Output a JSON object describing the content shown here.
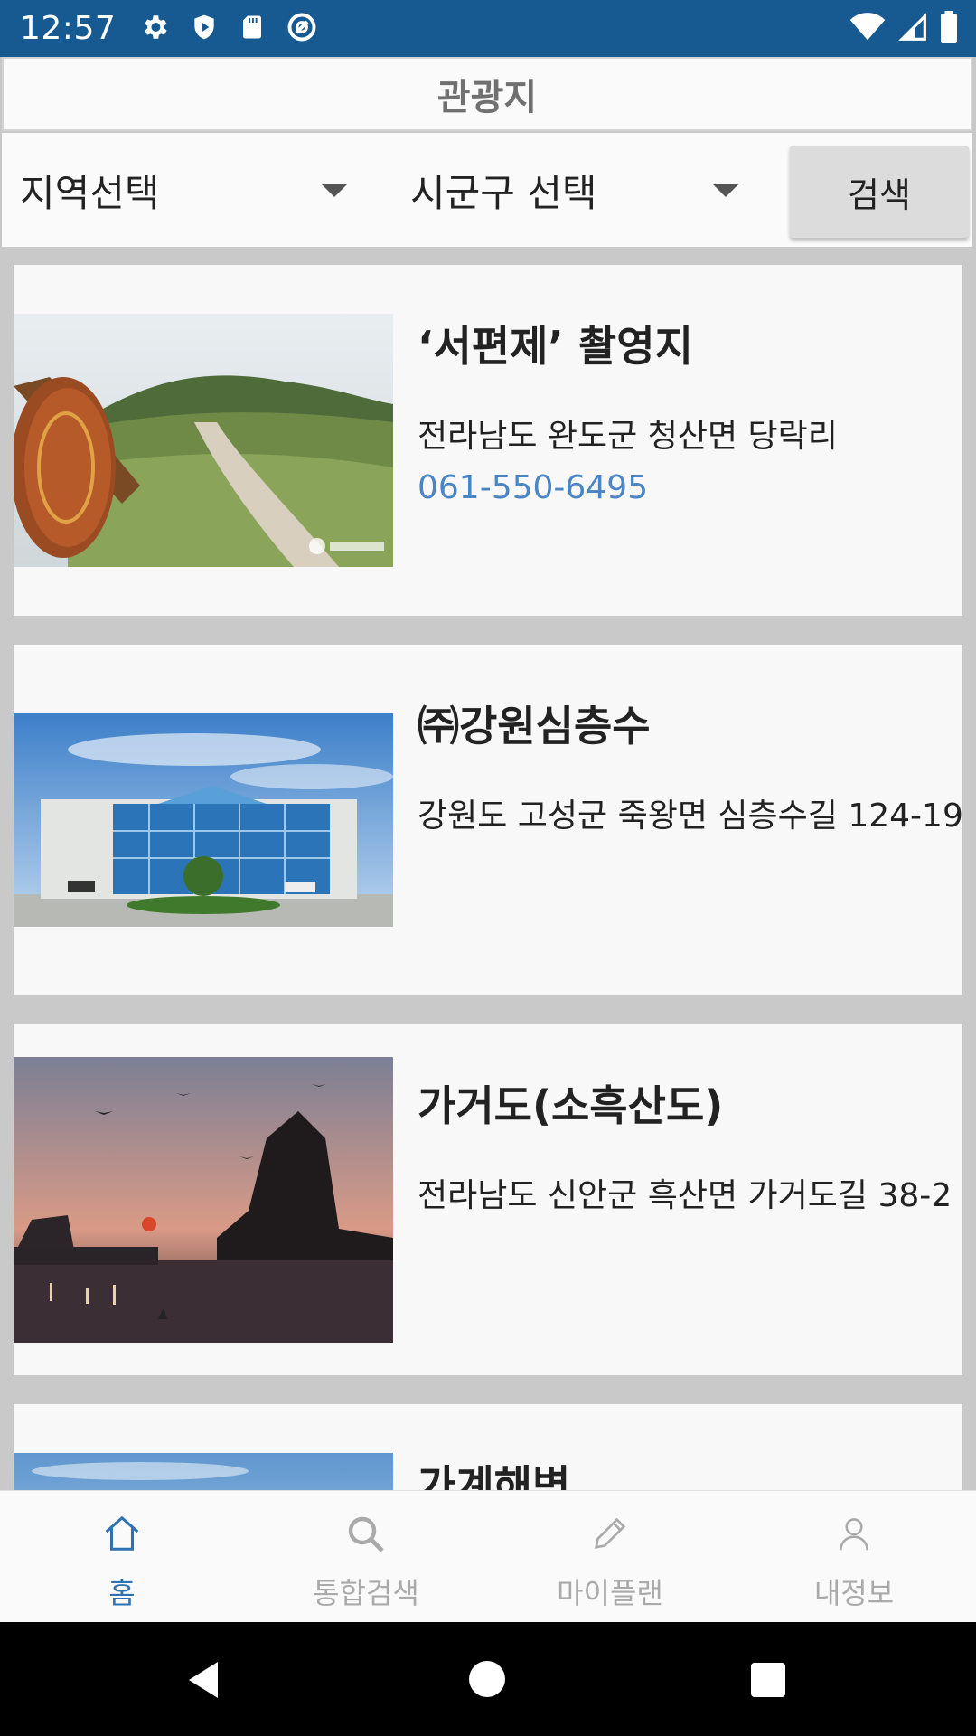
{
  "status_bar": {
    "time": "12:57",
    "left_icons": [
      "gear-icon",
      "shield-icon",
      "sd-card-icon",
      "at-sign-icon"
    ],
    "right_icons": [
      "wifi-icon",
      "signal-icon",
      "battery-icon"
    ]
  },
  "header": {
    "title": "관광지"
  },
  "filters": {
    "region_select": "지역선택",
    "district_select": "시군구 선택",
    "search_button": "검색"
  },
  "places": [
    {
      "title": "‘서편제’ 촬영지",
      "address": "전라남도 완도군 청산면 당락리",
      "phone": "061-550-6495",
      "image": "hill-path-photo"
    },
    {
      "title": "㈜강원심층수",
      "address": "강원도 고성군 죽왕면 심층수길 124-19",
      "image": "glass-building-photo"
    },
    {
      "title": "가거도(소흑산도)",
      "address": "전라남도 신안군 흑산면 가거도길 38-2",
      "image": "sunset-rock-photo"
    },
    {
      "title": "가계해변",
      "image": "sky-photo"
    }
  ],
  "bottom_nav": {
    "items": [
      {
        "label": "홈",
        "icon": "home-icon",
        "active": true
      },
      {
        "label": "통합검색",
        "icon": "search-icon",
        "active": false
      },
      {
        "label": "마이플랜",
        "icon": "pencil-icon",
        "active": false
      },
      {
        "label": "내정보",
        "icon": "person-icon",
        "active": false
      }
    ]
  },
  "colors": {
    "status_bar": "#175a92",
    "accent": "#2f72b3",
    "phone_link": "#4a86c5"
  }
}
